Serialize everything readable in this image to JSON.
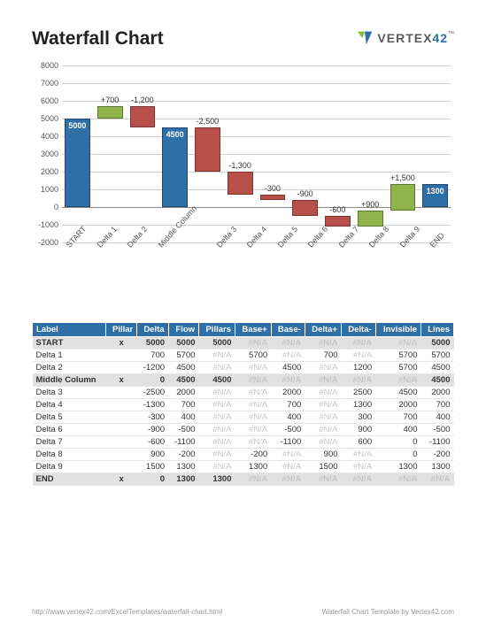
{
  "header": {
    "title": "Waterfall Chart",
    "brand": "VERTEX",
    "brand_suffix": "42",
    "tm": "™"
  },
  "chart_data": {
    "type": "bar",
    "title": "",
    "ylim": [
      -2000,
      8000
    ],
    "yticks": [
      -2000,
      -1000,
      0,
      1000,
      2000,
      3000,
      4000,
      5000,
      6000,
      7000,
      8000
    ],
    "categories": [
      "START",
      "Delta 1",
      "Delta 2",
      "Middle Column",
      "Delta 3",
      "Delta 4",
      "Delta 5",
      "Delta 6",
      "Delta 7",
      "Delta 8",
      "Delta 9",
      "END"
    ],
    "series": [
      {
        "name": "pillar",
        "values": [
          5000,
          null,
          null,
          4500,
          null,
          null,
          null,
          null,
          null,
          null,
          null,
          1300
        ]
      },
      {
        "name": "delta",
        "values": [
          null,
          700,
          -1200,
          null,
          -2500,
          -1300,
          -300,
          -900,
          -600,
          900,
          1500,
          null
        ]
      },
      {
        "name": "flow",
        "values": [
          5000,
          5700,
          4500,
          4500,
          2000,
          700,
          400,
          -500,
          -1100,
          -200,
          1300,
          1300
        ]
      }
    ],
    "data_labels": [
      "5000",
      "+700",
      "-1,200",
      "4500",
      "-2,500",
      "-1,300",
      "-300",
      "-900",
      "-600",
      "+900",
      "+1,500",
      "1300"
    ]
  },
  "table": {
    "headers": [
      "Label",
      "Pillar",
      "Delta",
      "Flow",
      "Pillars",
      "Base+",
      "Base-",
      "Delta+",
      "Delta-",
      "Invisible",
      "Lines"
    ],
    "rows": [
      {
        "label": "START",
        "pillar": "x",
        "delta": "5000",
        "flow": "5000",
        "pillars": "5000",
        "basep": "#N/A",
        "basen": "#N/A",
        "deltap": "#N/A",
        "deltan": "#N/A",
        "inv": "#N/A",
        "lines": "5000",
        "total": true
      },
      {
        "label": "Delta 1",
        "pillar": "",
        "delta": "700",
        "flow": "5700",
        "pillars": "#N/A",
        "basep": "5700",
        "basen": "#N/A",
        "deltap": "700",
        "deltan": "#N/A",
        "inv": "5700",
        "lines": "5700"
      },
      {
        "label": "Delta 2",
        "pillar": "",
        "delta": "-1200",
        "flow": "4500",
        "pillars": "#N/A",
        "basep": "#N/A",
        "basen": "4500",
        "deltap": "#N/A",
        "deltan": "1200",
        "inv": "5700",
        "lines": "4500"
      },
      {
        "label": "Middle Column",
        "pillar": "x",
        "delta": "0",
        "flow": "4500",
        "pillars": "4500",
        "basep": "#N/A",
        "basen": "#N/A",
        "deltap": "#N/A",
        "deltan": "#N/A",
        "inv": "#N/A",
        "lines": "4500",
        "total": true
      },
      {
        "label": "Delta 3",
        "pillar": "",
        "delta": "-2500",
        "flow": "2000",
        "pillars": "#N/A",
        "basep": "#N/A",
        "basen": "2000",
        "deltap": "#N/A",
        "deltan": "2500",
        "inv": "4500",
        "lines": "2000"
      },
      {
        "label": "Delta 4",
        "pillar": "",
        "delta": "-1300",
        "flow": "700",
        "pillars": "#N/A",
        "basep": "#N/A",
        "basen": "700",
        "deltap": "#N/A",
        "deltan": "1300",
        "inv": "2000",
        "lines": "700"
      },
      {
        "label": "Delta 5",
        "pillar": "",
        "delta": "-300",
        "flow": "400",
        "pillars": "#N/A",
        "basep": "#N/A",
        "basen": "400",
        "deltap": "#N/A",
        "deltan": "300",
        "inv": "700",
        "lines": "400"
      },
      {
        "label": "Delta 6",
        "pillar": "",
        "delta": "-900",
        "flow": "-500",
        "pillars": "#N/A",
        "basep": "#N/A",
        "basen": "-500",
        "deltap": "#N/A",
        "deltan": "900",
        "inv": "400",
        "lines": "-500"
      },
      {
        "label": "Delta 7",
        "pillar": "",
        "delta": "-600",
        "flow": "-1100",
        "pillars": "#N/A",
        "basep": "#N/A",
        "basen": "-1100",
        "deltap": "#N/A",
        "deltan": "600",
        "inv": "0",
        "lines": "-1100"
      },
      {
        "label": "Delta 8",
        "pillar": "",
        "delta": "900",
        "flow": "-200",
        "pillars": "#N/A",
        "basep": "-200",
        "basen": "#N/A",
        "deltap": "900",
        "deltan": "#N/A",
        "inv": "0",
        "lines": "-200"
      },
      {
        "label": "Delta 9",
        "pillar": "",
        "delta": "1500",
        "flow": "1300",
        "pillars": "#N/A",
        "basep": "1300",
        "basen": "#N/A",
        "deltap": "1500",
        "deltan": "#N/A",
        "inv": "1300",
        "lines": "1300"
      },
      {
        "label": "END",
        "pillar": "x",
        "delta": "0",
        "flow": "1300",
        "pillars": "1300",
        "basep": "#N/A",
        "basen": "#N/A",
        "deltap": "#N/A",
        "deltan": "#N/A",
        "inv": "#N/A",
        "lines": "#N/A",
        "total": true
      }
    ]
  },
  "footer": {
    "left": "http://www.vertex42.com/ExcelTemplates/waterfall-chart.html",
    "right": "Waterfall Chart Template by Vertex42.com"
  }
}
